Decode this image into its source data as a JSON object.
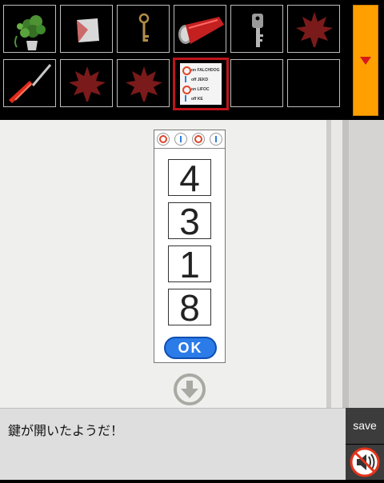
{
  "inventory": {
    "items": [
      {
        "name": "potted-plant-icon",
        "selected": false
      },
      {
        "name": "paper-scrap-icon",
        "selected": false
      },
      {
        "name": "old-key-icon",
        "selected": false
      },
      {
        "name": "red-flashlight-icon",
        "selected": false
      },
      {
        "name": "silver-key-icon",
        "selected": false
      },
      {
        "name": "maple-leaf-icon",
        "selected": false
      },
      {
        "name": "screwdriver-icon",
        "selected": false
      },
      {
        "name": "maple-leaf-icon",
        "selected": false
      },
      {
        "name": "maple-leaf-icon",
        "selected": false
      },
      {
        "name": "hint-card-icon",
        "selected": true
      },
      {
        "name": "empty-slot",
        "selected": false
      },
      {
        "name": "empty-slot",
        "selected": false
      }
    ],
    "hint_card": {
      "lines": [
        {
          "symbol": "O",
          "state": "on",
          "word": "FALCHDOG"
        },
        {
          "symbol": "I",
          "state": "off",
          "word": "JEKD"
        },
        {
          "symbol": "O",
          "state": "on",
          "word": "LIFOC"
        },
        {
          "symbol": "I",
          "state": "off",
          "word": "KE"
        }
      ]
    },
    "toggle_icon": "triangle-down-icon",
    "toggle_color": "#ffa000"
  },
  "lock": {
    "symbols": [
      "O",
      "I",
      "O",
      "I"
    ],
    "digits": [
      "4",
      "3",
      "1",
      "8"
    ],
    "ok_label": "OK"
  },
  "scene": {
    "down_icon": "circle-down-arrow-icon"
  },
  "message": {
    "text": "鍵が開いたようだ！"
  },
  "controls": {
    "save_label": "save",
    "sound_icon": "speaker-muted-icon"
  },
  "colors": {
    "accent": "#ffa000",
    "ok_button": "#2b7be9",
    "selected_border": "#c0141a",
    "symbol_o": "#e0452a",
    "symbol_i": "#2f7fd8"
  }
}
